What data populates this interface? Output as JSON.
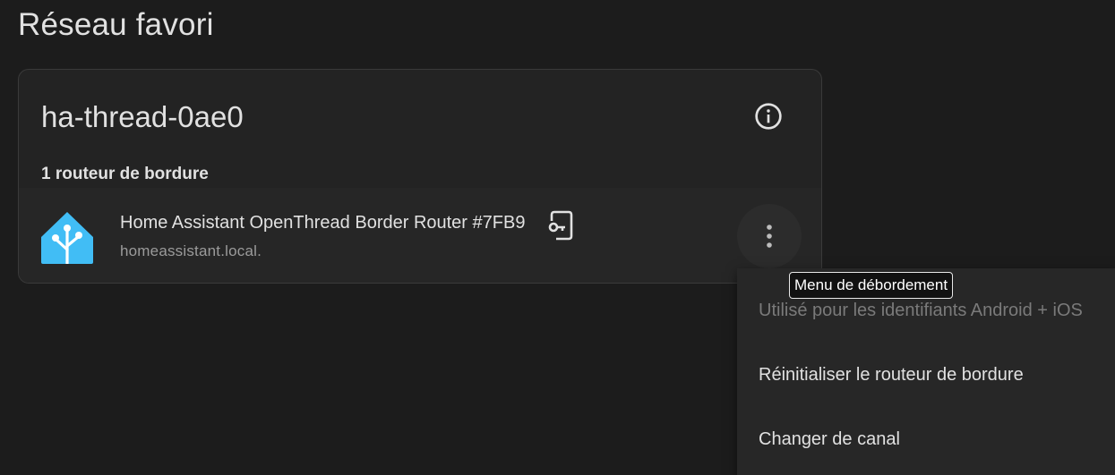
{
  "page": {
    "title": "Réseau favori"
  },
  "card": {
    "network_name": "ha-thread-0ae0",
    "info_icon": "info-circle-icon",
    "router_count_label": "1 routeur de bordure",
    "router": {
      "name": "Home Assistant OpenThread Border Router #7FB9",
      "host": "homeassistant.local.",
      "logo_icon": "home-assistant-logo",
      "credentials_icon": "phone-key-icon",
      "overflow_icon": "dots-vertical-icon"
    }
  },
  "tooltip": {
    "text": "Menu de débordement"
  },
  "menu": {
    "items": [
      {
        "label": "Utilisé pour les identifiants Android + iOS",
        "disabled": true
      },
      {
        "label": "Réinitialiser le routeur de bordure",
        "disabled": false
      },
      {
        "label": "Changer de canal",
        "disabled": false
      }
    ]
  },
  "colors": {
    "background": "#1c1c1c",
    "card": "#232323",
    "logo_blue": "#41bdf5",
    "text": "#e1e1e1",
    "secondary_text": "#9b9b9b",
    "disabled_text": "#7a7a7a"
  }
}
